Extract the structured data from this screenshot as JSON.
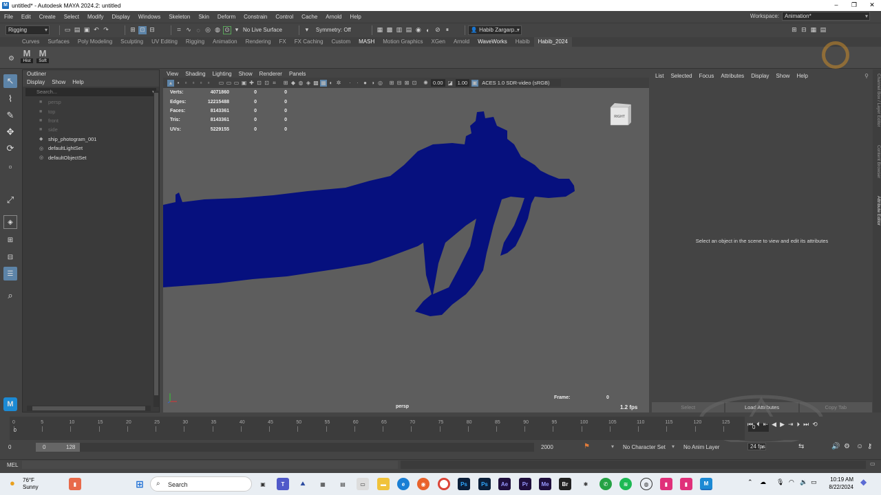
{
  "window": {
    "title": "untitled* - Autodesk MAYA 2024.2: untitled",
    "logo": "M"
  },
  "menubar": {
    "items": [
      "File",
      "Edit",
      "Create",
      "Select",
      "Modify",
      "Display",
      "Windows",
      "Skeleton",
      "Skin",
      "Deform",
      "Constrain",
      "Control",
      "Cache",
      "Arnold",
      "Help"
    ],
    "workspace_label": "Workspace:",
    "workspace_value": "Animation*"
  },
  "statusline": {
    "mode": "Rigging",
    "live_surface": "No Live Surface",
    "symmetry": "Symmetry: Off",
    "user": "Habib Zargarp..."
  },
  "shelf": {
    "tabs": [
      "Curves",
      "Surfaces",
      "Poly Modeling",
      "Sculpting",
      "UV Editing",
      "Rigging",
      "Animation",
      "Rendering",
      "FX",
      "FX Caching",
      "Custom",
      "MASH",
      "Motion Graphics",
      "XGen",
      "Arnold",
      "WaveWorks",
      "Habib",
      "Habib_2024"
    ],
    "active": "Habib_2024",
    "buttons": [
      {
        "icon": "M",
        "label": "Hist"
      },
      {
        "icon": "M",
        "label": "Soft"
      }
    ]
  },
  "outliner": {
    "title": "Outliner",
    "menu": [
      "Display",
      "Show",
      "Help"
    ],
    "search_placeholder": "Search...",
    "items": [
      {
        "name": "persp",
        "dim": true
      },
      {
        "name": "top",
        "dim": true
      },
      {
        "name": "front",
        "dim": true
      },
      {
        "name": "side",
        "dim": true
      },
      {
        "name": "ship_photogram_001",
        "dim": false
      },
      {
        "name": "defaultLightSet",
        "dim": false
      },
      {
        "name": "defaultObjectSet",
        "dim": false
      }
    ]
  },
  "viewport": {
    "menu": [
      "View",
      "Shading",
      "Lighting",
      "Show",
      "Renderer",
      "Panels"
    ],
    "exposure": "0.00",
    "gamma": "1.00",
    "color_space": "ACES 1.0 SDR-video (sRGB)",
    "hud": [
      {
        "label": "Verts:",
        "a": "4071860",
        "b": "0",
        "c": "0"
      },
      {
        "label": "Edges:",
        "a": "12215488",
        "b": "0",
        "c": "0"
      },
      {
        "label": "Faces:",
        "a": "8143361",
        "b": "0",
        "c": "0"
      },
      {
        "label": "Tris:",
        "a": "8143361",
        "b": "0",
        "c": "0"
      },
      {
        "label": "UVs:",
        "a": "5229155",
        "b": "0",
        "c": "0"
      }
    ],
    "viewcube_label": "RIGHT",
    "camera": "persp",
    "frame_label": "Frame:",
    "frame_value": "0",
    "fps": "1.2 fps",
    "model_color": "#06107e"
  },
  "attribute_editor": {
    "menu": [
      "List",
      "Selected",
      "Focus",
      "Attributes",
      "Display",
      "Show",
      "Help"
    ],
    "message": "Select an object in the scene to view and edit its attributes",
    "buttons": [
      "Select",
      "Load Attributes",
      "Copy Tab"
    ]
  },
  "side_tabs": [
    "Channel Box / Layer Editor",
    "Content Browser",
    "Attribute Editor"
  ],
  "timeline": {
    "ticks": [
      "0",
      "5",
      "10",
      "15",
      "20",
      "25",
      "30",
      "35",
      "40",
      "45",
      "50",
      "55",
      "60",
      "65",
      "70",
      "75",
      "80",
      "85",
      "90",
      "95",
      "100",
      "105",
      "110",
      "115",
      "120",
      "125"
    ],
    "current": "0",
    "current_field": "0"
  },
  "range": {
    "start": "0",
    "inner_start": "0",
    "inner_end": "128",
    "end": "2000",
    "character_set": "No Character Set",
    "anim_layer": "No Anim Layer",
    "fps": "24 fps"
  },
  "command_line": {
    "label": "MEL"
  },
  "taskbar": {
    "weather_temp": "76°F",
    "weather_desc": "Sunny",
    "search": "Search",
    "time": "10:19 AM",
    "date": "8/22/2024",
    "apps": [
      "Ps",
      "Ps",
      "Ae",
      "Pr",
      "Me",
      "Br"
    ]
  }
}
